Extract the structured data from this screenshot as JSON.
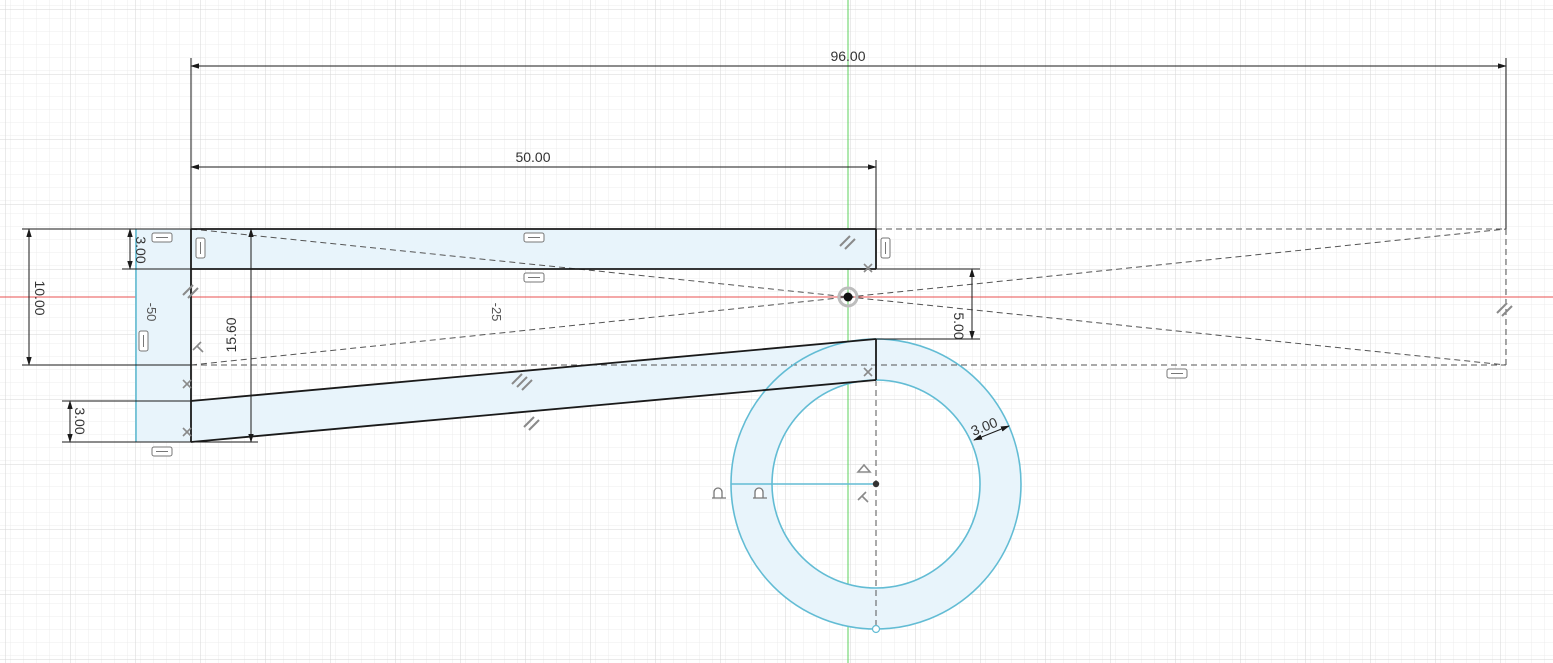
{
  "colors": {
    "background": "#ffffff",
    "grid_minor": "#ececec",
    "grid_major": "#d6d6d6",
    "x_axis": "#e85050",
    "y_axis": "#5cd05c",
    "profile_fill": "#e8f4fb",
    "profile_stroke": "#1a1a1a",
    "circle_stroke": "#62bcd4",
    "construction": "#555555",
    "dimension": "#1a1a1a"
  },
  "dimensions": {
    "total_width": "96.00",
    "top_bar_width": "50.00",
    "left_height": "10.00",
    "top_bar_thickness": "3.00",
    "inner_height": "15.60",
    "right_offset": "5.00",
    "bottom_thickness": "3.00",
    "ring_thickness": "3.00",
    "angle_left": "-50",
    "angle_mid": "-25"
  },
  "constraints": {
    "horizontal": "horizontal-constraint-icon",
    "parallel": "parallel-constraint-icon",
    "perpendicular": "perpendicular-constraint-icon",
    "coincident": "coincident-icon",
    "tangent": "tangent-constraint-icon"
  }
}
